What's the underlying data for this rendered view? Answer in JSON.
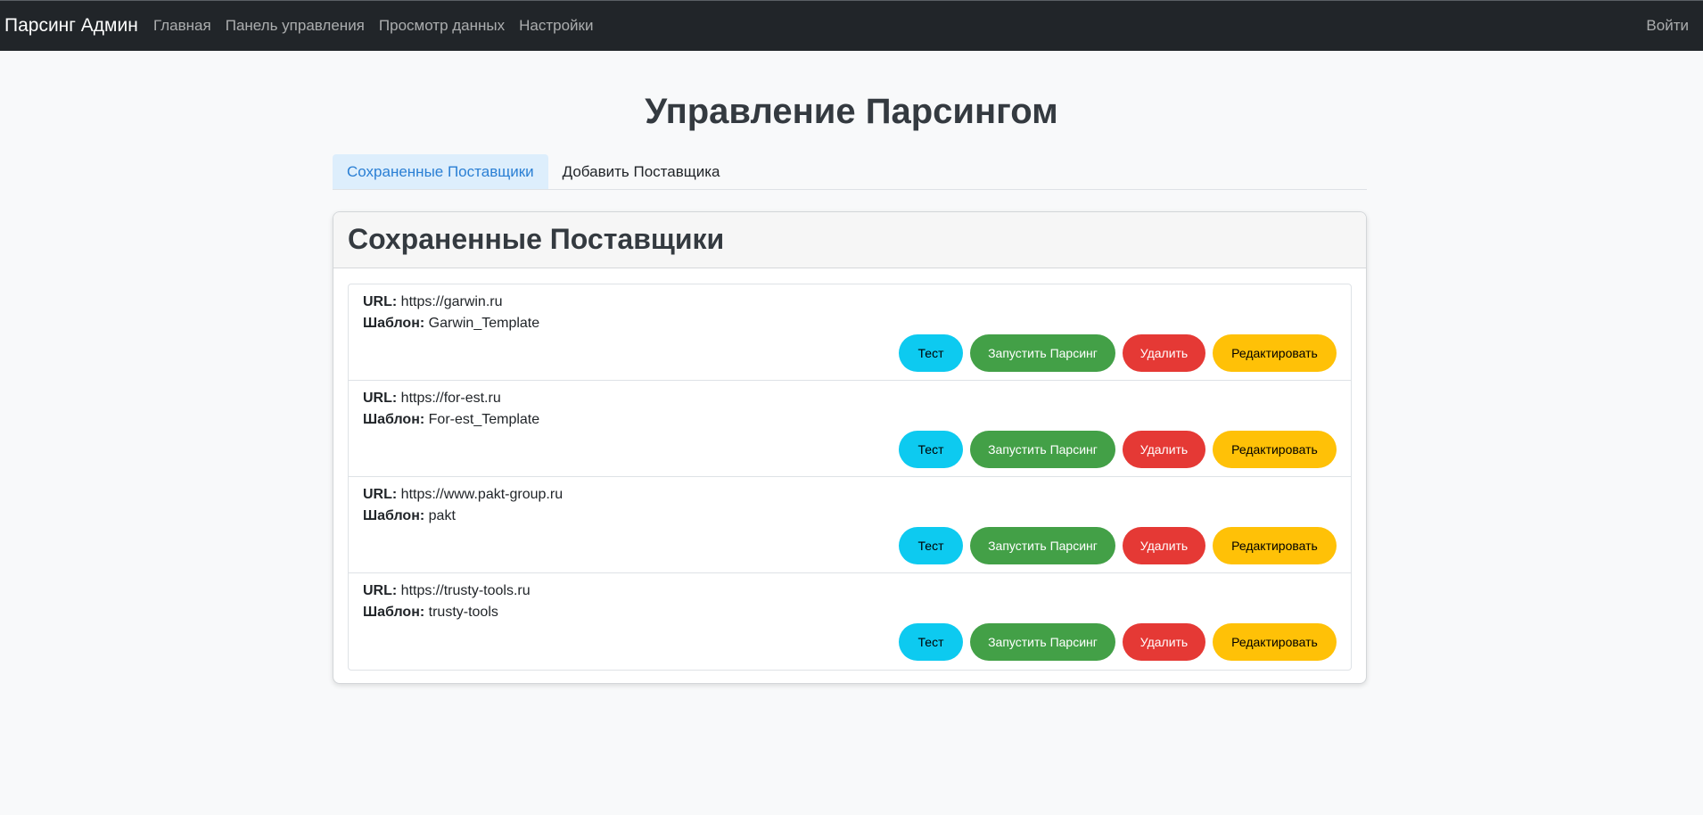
{
  "navbar": {
    "brand": "Парсинг Админ",
    "links": [
      "Главная",
      "Панель управления",
      "Просмотр данных",
      "Настройки"
    ],
    "login": "Войти"
  },
  "page": {
    "title": "Управление Парсингом"
  },
  "tabs": [
    "Сохраненные Поставщики",
    "Добавить Поставщика"
  ],
  "card": {
    "title": "Сохраненные Поставщики"
  },
  "labels": {
    "url": "URL:",
    "template": "Шаблон:"
  },
  "buttons": {
    "test": "Тест",
    "run": "Запустить Парсинг",
    "delete": "Удалить",
    "edit": "Редактировать"
  },
  "colors": {
    "test": "#0dcaf0",
    "run": "#43a047",
    "delete": "#e53935",
    "edit": "#ffc107",
    "navbar": "#212529"
  },
  "suppliers": [
    {
      "url": "https://garwin.ru",
      "template": "Garwin_Template"
    },
    {
      "url": "https://for-est.ru",
      "template": "For-est_Template"
    },
    {
      "url": "https://www.pakt-group.ru",
      "template": "pakt"
    },
    {
      "url": "https://trusty-tools.ru",
      "template": "trusty-tools"
    }
  ]
}
